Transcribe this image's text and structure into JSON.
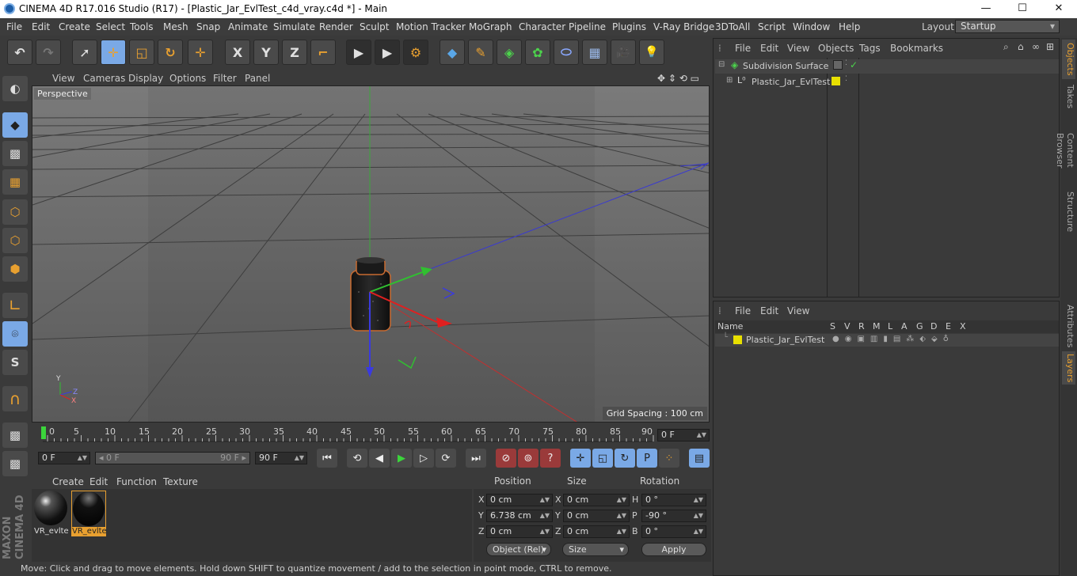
{
  "window": {
    "title": "CINEMA 4D R17.016 Studio (R17) - [Plastic_Jar_EvlTest_c4d_vray.c4d *] - Main",
    "minimize": "—",
    "maximize": "☐",
    "close": "✕"
  },
  "menubar": {
    "items": [
      "File",
      "Edit",
      "Create",
      "Select",
      "Tools",
      "Mesh",
      "Snap",
      "Animate",
      "Simulate",
      "Render",
      "Sculpt",
      "Motion Tracker",
      "MoGraph",
      "Character",
      "Pipeline",
      "Plugins",
      "V-Ray Bridge",
      "3DToAll",
      "Script",
      "Window",
      "Help"
    ],
    "layout_label": "Layout:",
    "layout_value": "Startup"
  },
  "toolbar": {
    "buttons": [
      {
        "name": "undo-button",
        "glyph": "↶"
      },
      {
        "name": "redo-button",
        "glyph": "↷"
      },
      {
        "name": "select-tool-button",
        "glyph": "➚"
      },
      {
        "name": "move-tool-button",
        "glyph": "✛"
      },
      {
        "name": "scale-tool-button",
        "glyph": "◱"
      },
      {
        "name": "rotate-tool-button",
        "glyph": "↻"
      },
      {
        "name": "recent-tool-button",
        "glyph": "✛"
      },
      {
        "name": "x-axis-button",
        "glyph": "X"
      },
      {
        "name": "y-axis-button",
        "glyph": "Y"
      },
      {
        "name": "z-axis-button",
        "glyph": "Z"
      },
      {
        "name": "coordinate-system-button",
        "glyph": "⌐"
      },
      {
        "name": "render-view-button",
        "glyph": "▶"
      },
      {
        "name": "render-picture-viewer-button",
        "glyph": "▶"
      },
      {
        "name": "render-settings-button",
        "glyph": "⚙"
      },
      {
        "name": "cube-button",
        "glyph": "◆"
      },
      {
        "name": "pen-button",
        "glyph": "✎"
      },
      {
        "name": "subdivision-button",
        "glyph": "◈"
      },
      {
        "name": "array-button",
        "glyph": "✿"
      },
      {
        "name": "deformer-button",
        "glyph": "⬭"
      },
      {
        "name": "floor-button",
        "glyph": "▦"
      },
      {
        "name": "camera-button",
        "glyph": "🎥"
      },
      {
        "name": "light-button",
        "glyph": "💡"
      }
    ]
  },
  "left_tools": {
    "buttons": [
      {
        "name": "make-editable-button",
        "glyph": "◐"
      },
      {
        "name": "model-mode-button",
        "glyph": "◆"
      },
      {
        "name": "texture-mode-button",
        "glyph": "▩"
      },
      {
        "name": "workplane-mode-button",
        "glyph": "▦"
      },
      {
        "name": "points-mode-button",
        "glyph": "⬡"
      },
      {
        "name": "edges-mode-button",
        "glyph": "⬡"
      },
      {
        "name": "polygons-mode-button",
        "glyph": "⬢"
      },
      {
        "name": "axis-mode-button",
        "glyph": "∟"
      },
      {
        "name": "tweak-mode-button",
        "glyph": "⌾"
      },
      {
        "name": "snapping-button",
        "glyph": "S"
      },
      {
        "name": "magnet-button",
        "glyph": "∩"
      },
      {
        "name": "workplane-lock-button",
        "glyph": "▩"
      },
      {
        "name": "grid-snap-button",
        "glyph": "▩"
      }
    ],
    "logo_line1": "MAXON",
    "logo_line2": "CINEMA 4D"
  },
  "viewport": {
    "menu": [
      "View",
      "Cameras",
      "Display",
      "Options",
      "Filter",
      "Panel"
    ],
    "camera_label": "Perspective",
    "grid_spacing": "Grid Spacing : 100 cm",
    "axis_y": "Y",
    "axis_z": "Z",
    "axis_x": "X"
  },
  "timeline": {
    "ticks": [
      "0",
      "5",
      "10",
      "15",
      "20",
      "25",
      "30",
      "35",
      "40",
      "45",
      "50",
      "55",
      "60",
      "65",
      "70",
      "75",
      "80",
      "85",
      "90"
    ],
    "current_frame": "0 F"
  },
  "transport": {
    "start_field": "0 F",
    "range_start": "◂ 0 F",
    "range_end": "90 F ▸",
    "end_field": "90 F",
    "buttons": [
      {
        "name": "goto-start-button",
        "glyph": "⏮"
      },
      {
        "name": "prev-key-button",
        "glyph": "⟲"
      },
      {
        "name": "prev-frame-button",
        "glyph": "◀"
      },
      {
        "name": "play-button",
        "glyph": "▶"
      },
      {
        "name": "next-frame-button",
        "glyph": "▷"
      },
      {
        "name": "next-key-button",
        "glyph": "⟳"
      },
      {
        "name": "goto-end-button",
        "glyph": "⏭"
      },
      {
        "name": "record-button",
        "glyph": "⊘"
      },
      {
        "name": "autokey-button",
        "glyph": "⊚"
      },
      {
        "name": "keyframe-selection-button",
        "glyph": "?"
      },
      {
        "name": "key-position-button",
        "glyph": "✛"
      },
      {
        "name": "key-scale-button",
        "glyph": "◱"
      },
      {
        "name": "key-rotation-button",
        "glyph": "↻"
      },
      {
        "name": "key-param-button",
        "glyph": "P"
      },
      {
        "name": "key-pla-button",
        "glyph": "⁘"
      },
      {
        "name": "timeline-button",
        "glyph": "▤"
      }
    ]
  },
  "materials": {
    "menu": [
      "Create",
      "Edit",
      "Function",
      "Texture"
    ],
    "items": [
      {
        "label": "VR_evlte",
        "selected": false
      },
      {
        "label": "VR_evlte",
        "selected": true
      }
    ]
  },
  "coordinates": {
    "headers": [
      "Position",
      "Size",
      "Rotation"
    ],
    "rows": [
      {
        "pos_axis": "X",
        "pos": "0 cm",
        "size_axis": "X",
        "size": "0 cm",
        "rot_axis": "H",
        "rot": "0 °"
      },
      {
        "pos_axis": "Y",
        "pos": "6.738 cm",
        "size_axis": "Y",
        "size": "0 cm",
        "rot_axis": "P",
        "rot": "-90 °"
      },
      {
        "pos_axis": "Z",
        "pos": "0 cm",
        "size_axis": "Z",
        "size": "0 cm",
        "rot_axis": "B",
        "rot": "0 °"
      }
    ],
    "mode_select": "Object (Rel)",
    "size_select": "Size",
    "apply": "Apply"
  },
  "status": {
    "text": "Move: Click and drag to move elements. Hold down SHIFT to quantize movement / add to the selection in point mode, CTRL to remove."
  },
  "objects_panel": {
    "menu": [
      "File",
      "Edit",
      "View",
      "Objects",
      "Tags",
      "Bookmarks"
    ],
    "items": [
      {
        "label": "Subdivision Surface",
        "color": "#e8a030"
      },
      {
        "label": "Plastic_Jar_EvlTest",
        "color": "#e8e000"
      }
    ]
  },
  "layers_panel": {
    "menu": [
      "File",
      "Edit",
      "View"
    ],
    "columns": [
      "Name",
      "S",
      "V",
      "R",
      "M",
      "L",
      "A",
      "G",
      "D",
      "E",
      "X"
    ],
    "rows": [
      {
        "label": "Plastic_Jar_EvlTest",
        "color": "#e8e000"
      }
    ]
  },
  "right_tabs": {
    "objects": "Objects",
    "takes": "Takes",
    "content_browser": "Content Browser",
    "structure": "Structure",
    "attributes": "Attributes",
    "layers": "Layers"
  },
  "colors": {
    "accent_blue": "#7aa9e6",
    "highlight_orange": "#e8a030",
    "layer_yellow": "#e8e000"
  }
}
